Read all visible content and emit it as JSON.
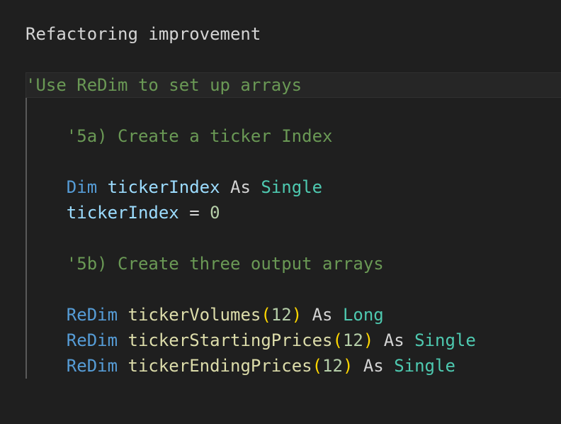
{
  "title": "Refactoring improvement",
  "code_lines": [
    {
      "tokens": [
        {
          "t": "'Use ReDim to set up arrays",
          "k": "comment"
        }
      ]
    },
    {
      "tokens": []
    },
    {
      "tokens": [
        {
          "t": "    ",
          "k": "plain"
        },
        {
          "t": "'5a) Create a ticker Index",
          "k": "comment"
        }
      ]
    },
    {
      "tokens": []
    },
    {
      "tokens": [
        {
          "t": "    ",
          "k": "plain"
        },
        {
          "t": "Dim",
          "k": "keyword"
        },
        {
          "t": " ",
          "k": "plain"
        },
        {
          "t": "tickerIndex",
          "k": "variable"
        },
        {
          "t": " As ",
          "k": "plain"
        },
        {
          "t": "Single",
          "k": "type"
        }
      ]
    },
    {
      "tokens": [
        {
          "t": "    ",
          "k": "plain"
        },
        {
          "t": "tickerIndex",
          "k": "variable"
        },
        {
          "t": " = ",
          "k": "plain"
        },
        {
          "t": "0",
          "k": "number"
        }
      ]
    },
    {
      "tokens": []
    },
    {
      "tokens": [
        {
          "t": "    ",
          "k": "plain"
        },
        {
          "t": "'5b) Create three output arrays",
          "k": "comment"
        }
      ]
    },
    {
      "tokens": []
    },
    {
      "tokens": [
        {
          "t": "    ",
          "k": "plain"
        },
        {
          "t": "ReDim",
          "k": "keyword"
        },
        {
          "t": " ",
          "k": "plain"
        },
        {
          "t": "tickerVolumes",
          "k": "function"
        },
        {
          "t": "(",
          "k": "bracket"
        },
        {
          "t": "12",
          "k": "number"
        },
        {
          "t": ")",
          "k": "bracket"
        },
        {
          "t": " As ",
          "k": "plain"
        },
        {
          "t": "Long",
          "k": "type"
        }
      ]
    },
    {
      "tokens": [
        {
          "t": "    ",
          "k": "plain"
        },
        {
          "t": "ReDim",
          "k": "keyword"
        },
        {
          "t": " ",
          "k": "plain"
        },
        {
          "t": "tickerStartingPrices",
          "k": "function"
        },
        {
          "t": "(",
          "k": "bracket"
        },
        {
          "t": "12",
          "k": "number"
        },
        {
          "t": ")",
          "k": "bracket"
        },
        {
          "t": " As ",
          "k": "plain"
        },
        {
          "t": "Single",
          "k": "type"
        }
      ]
    },
    {
      "tokens": [
        {
          "t": "    ",
          "k": "plain"
        },
        {
          "t": "ReDim",
          "k": "keyword"
        },
        {
          "t": " ",
          "k": "plain"
        },
        {
          "t": "tickerEndingPrices",
          "k": "function"
        },
        {
          "t": "(",
          "k": "bracket"
        },
        {
          "t": "12",
          "k": "number"
        },
        {
          "t": ")",
          "k": "bracket"
        },
        {
          "t": " As ",
          "k": "plain"
        },
        {
          "t": "Single",
          "k": "type"
        }
      ]
    }
  ],
  "colors": {
    "background": "#1f1f1f",
    "comment": "#6a9955",
    "keyword": "#569cd6",
    "variable": "#9cdcfe",
    "function": "#dcdcaa",
    "type": "#4ec9b0",
    "number": "#b5cea8",
    "bracket": "#ffd700"
  }
}
